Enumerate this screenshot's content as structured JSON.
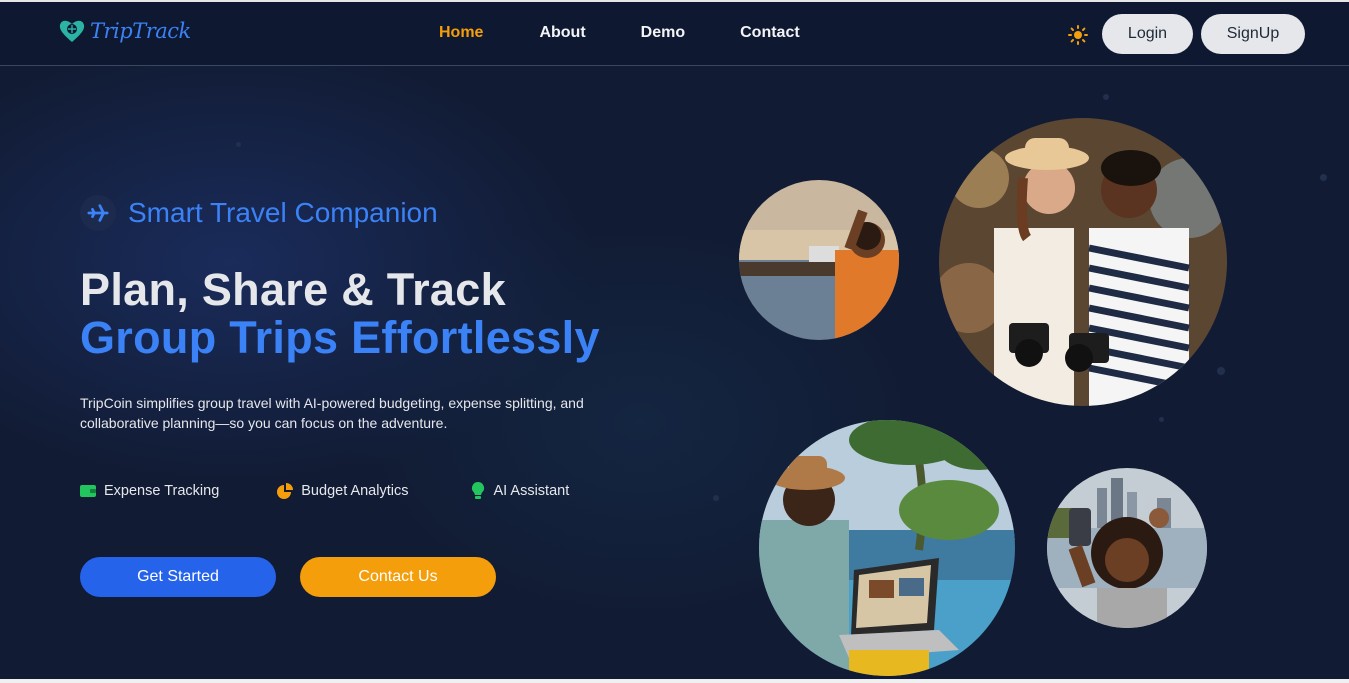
{
  "nav": {
    "logo_text": "TripTrack",
    "links": [
      "Home",
      "About",
      "Demo",
      "Contact"
    ],
    "active_link": "Home",
    "theme_icon": "sun-icon",
    "login_label": "Login",
    "signup_label": "SignUp"
  },
  "hero": {
    "badge_icon": "plane-icon",
    "badge": "Smart Travel Companion",
    "title_line1": "Plan, Share & Track",
    "title_line2": "Group Trips Effortlessly",
    "description": "TripCoin simplifies group travel with AI-powered budgeting, expense splitting, and collaborative planning—so you can focus on the adventure.",
    "features": [
      {
        "icon": "wallet-icon",
        "label": "Expense Tracking",
        "color": "#22c55e"
      },
      {
        "icon": "pie-chart-icon",
        "label": "Budget Analytics",
        "color": "#f59e0b"
      },
      {
        "icon": "lightbulb-icon",
        "label": "AI Assistant",
        "color": "#22c55e"
      }
    ],
    "primary_cta": "Get Started",
    "secondary_cta": "Contact Us"
  },
  "photos": [
    {
      "name": "selfie-at-pier-photo"
    },
    {
      "name": "two-travelers-with-cameras-photo"
    },
    {
      "name": "man-with-laptop-by-pool-photo"
    },
    {
      "name": "woman-selfie-city-photo"
    }
  ],
  "colors": {
    "background": "#111b33",
    "accent_blue": "#3b82f6",
    "accent_orange": "#f59e0b",
    "primary_button": "#2563eb"
  }
}
